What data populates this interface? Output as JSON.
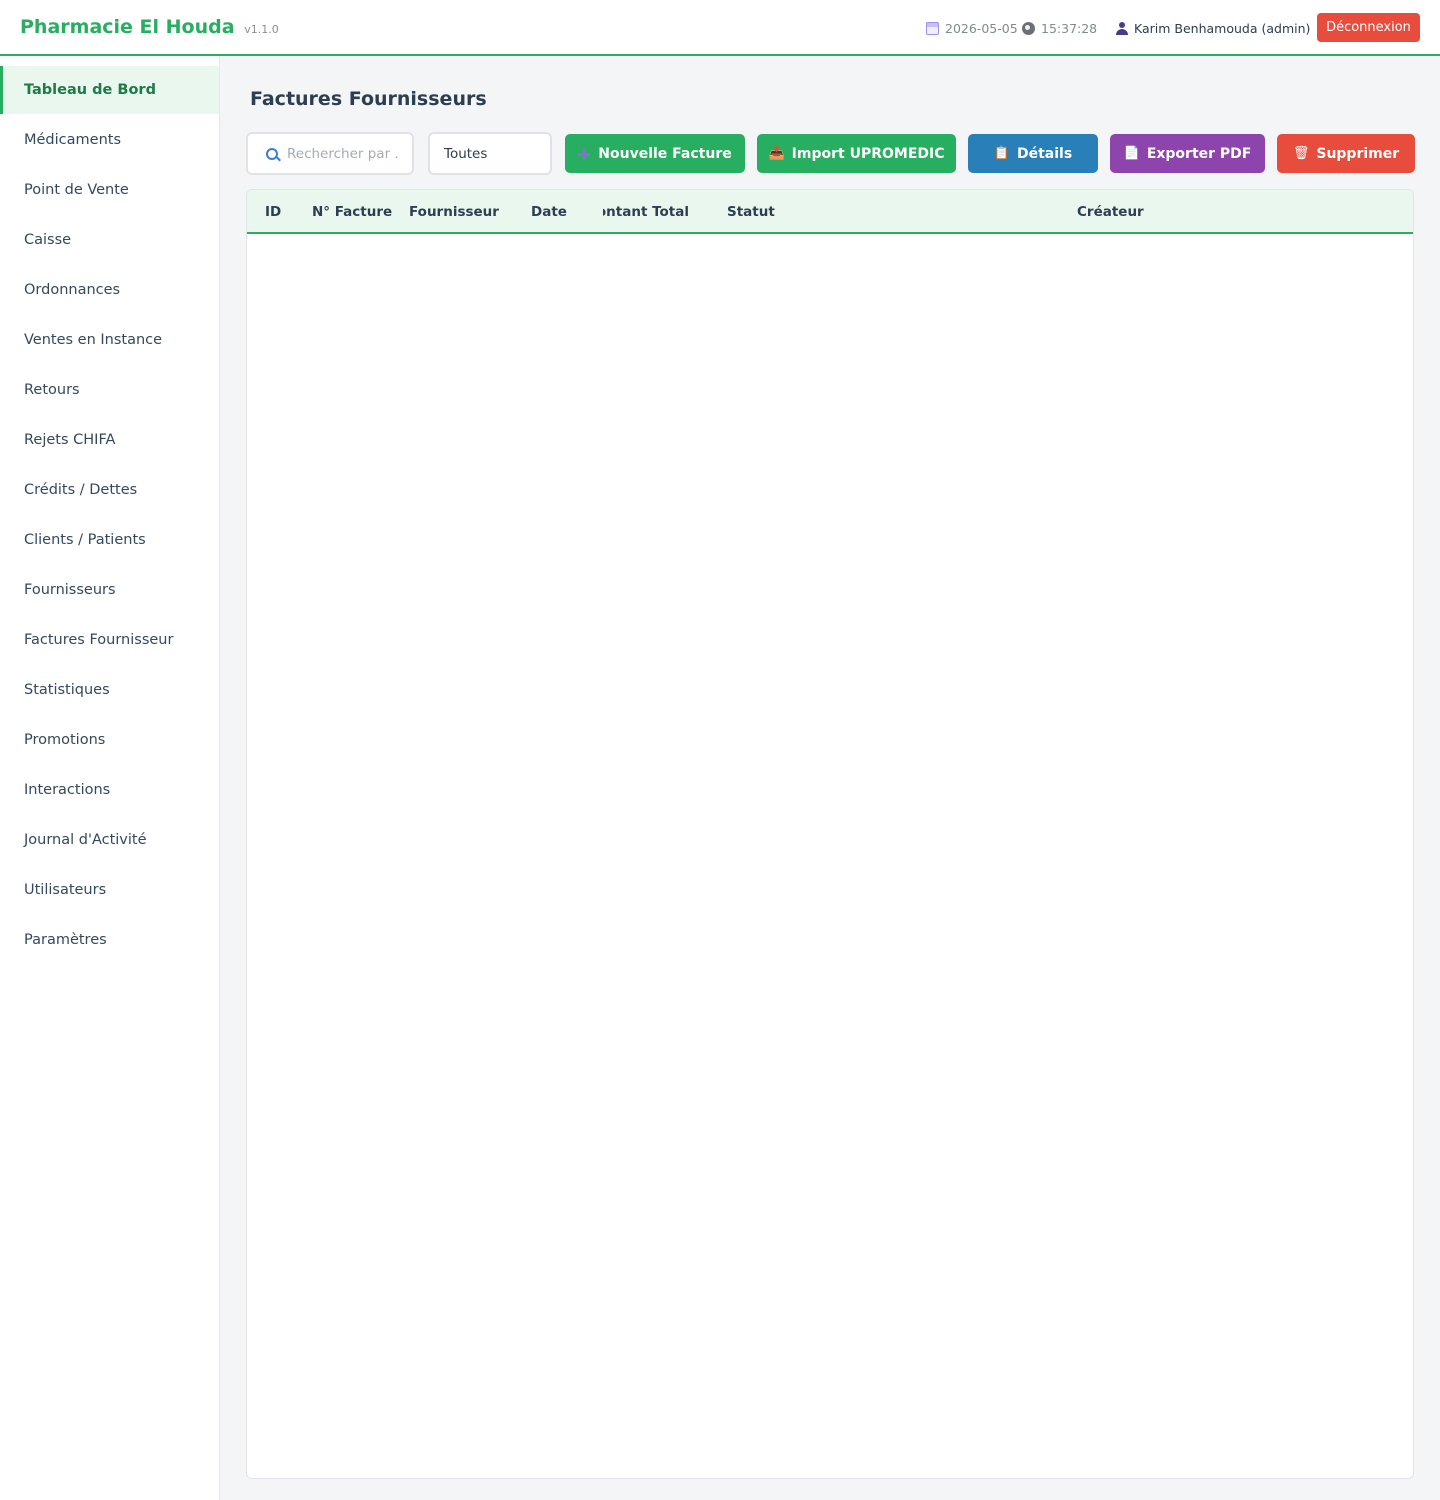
{
  "header": {
    "app_name": "Pharmacie El Houda",
    "version": "v1.1.0",
    "date": "2026-05-05",
    "time": "15:37:28",
    "user": "Karim Benhamouda (admin)",
    "logout_label": "Déconnexion",
    "accent_color": "#27ae60"
  },
  "sidebar": {
    "items": [
      {
        "label": "Tableau de Bord",
        "active": true
      },
      {
        "label": "Médicaments"
      },
      {
        "label": "Point de Vente"
      },
      {
        "label": "Caisse"
      },
      {
        "label": "Ordonnances"
      },
      {
        "label": "Ventes en Instance"
      },
      {
        "label": "Retours"
      },
      {
        "label": "Rejets CHIFA"
      },
      {
        "label": "Crédits / Dettes"
      },
      {
        "label": "Clients / Patients"
      },
      {
        "label": "Fournisseurs"
      },
      {
        "label": "Factures Fournisseur"
      },
      {
        "label": "Statistiques"
      },
      {
        "label": "Promotions"
      },
      {
        "label": "Interactions"
      },
      {
        "label": "Journal d'Activité"
      },
      {
        "label": "Utilisateurs"
      },
      {
        "label": "Paramètres"
      }
    ]
  },
  "main": {
    "title": "Factures Fournisseurs",
    "search": {
      "placeholder": "Rechercher par ...",
      "value": ""
    },
    "filter": {
      "selected": "Toutes"
    },
    "toolbar": {
      "new_label": "Nouvelle Facture",
      "import_label": "Import UPROMEDIC",
      "details_label": "Détails",
      "pdf_label": "Exporter PDF",
      "delete_label": "Supprimer",
      "colors": {
        "new": "#27ae60",
        "import": "#27ae60",
        "details": "#2980b9",
        "pdf": "#8e44ad",
        "delete": "#e74c3c"
      }
    },
    "table": {
      "columns": [
        "ID",
        "N° Facture",
        "Fournisseur",
        "Date",
        "Montant Total",
        "Statut",
        "Créateur"
      ],
      "rows": []
    }
  }
}
